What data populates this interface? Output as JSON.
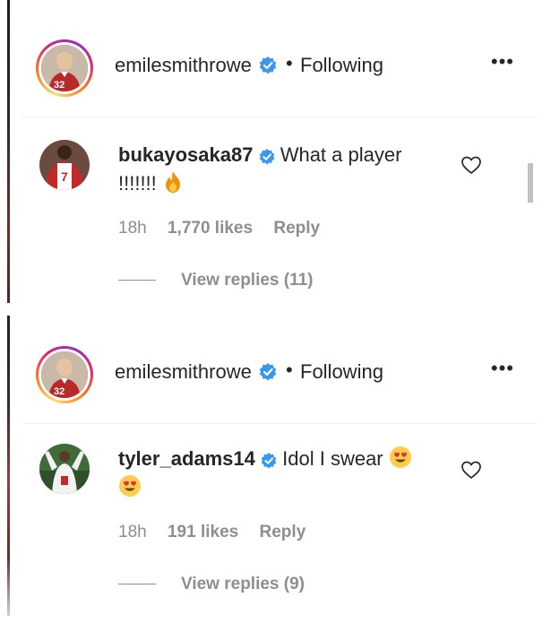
{
  "posts": [
    {
      "author": "emilesmithrowe",
      "follow_status": "Following",
      "separator": "•",
      "more_label": "•••",
      "comment": {
        "user": "bukayosaka87",
        "text": "What a player !!!!!!!",
        "emoji": "fire",
        "time": "18h",
        "likes": "1,770 likes",
        "reply_label": "Reply",
        "view_replies": "View replies (11)"
      }
    },
    {
      "author": "emilesmithrowe",
      "follow_status": "Following",
      "separator": "•",
      "more_label": "•••",
      "comment": {
        "user": "tyler_adams14",
        "text": "Idol I swear",
        "emoji": "heart-eyes",
        "time": "18h",
        "likes": "191 likes",
        "reply_label": "Reply",
        "view_replies": "View replies (9)"
      }
    }
  ],
  "colors": {
    "text": "#262626",
    "secondary": "#8e8e8e",
    "verified": "#3897f0",
    "divider": "#efefef"
  }
}
